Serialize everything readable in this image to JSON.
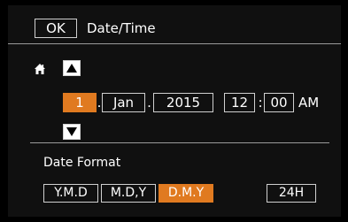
{
  "header": {
    "ok_label": "OK",
    "title": "Date/Time"
  },
  "icons": {
    "home": "home-icon",
    "up": "up-arrow-icon",
    "down": "down-arrow-icon"
  },
  "datetime": {
    "day": "1",
    "month": "Jan",
    "year": "2015",
    "hour": "12",
    "minute": "00",
    "ampm": "AM",
    "sep_date": ".",
    "sep_time": ":"
  },
  "date_format": {
    "label": "Date Format",
    "options": [
      "Y.M.D",
      "M.D,Y",
      "D.M.Y"
    ],
    "selected": "D.M.Y",
    "clock_label": "24H"
  },
  "colors": {
    "accent": "#e07a20",
    "border": "#d0d0d0",
    "background": "#101010"
  }
}
